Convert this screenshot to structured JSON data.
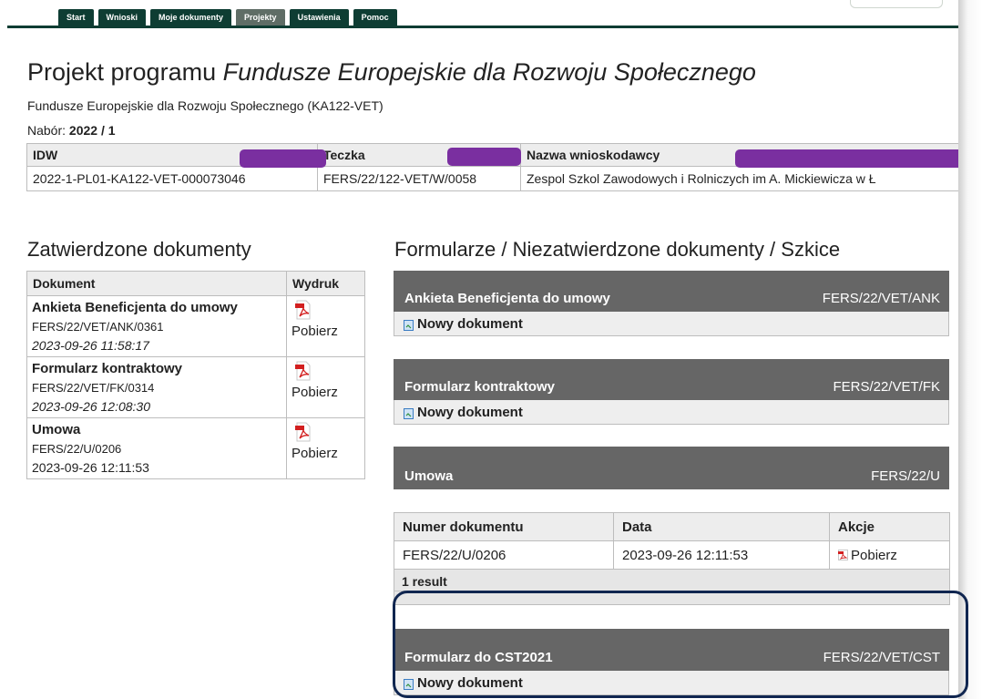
{
  "nav": {
    "tabs": [
      "Start",
      "Wnioski",
      "Moje dokumenty",
      "Projekty",
      "Ustawienia",
      "Pomoc"
    ],
    "active": "Projekty"
  },
  "header": {
    "title_prefix": "Projekt programu ",
    "title_italic": "Fundusze Europejskie dla Rozwoju Społecznego",
    "subtitle": "Fundusze Europejskie dla Rozwoju Społecznego (KA122-VET)",
    "nabor_label": "Nabór: ",
    "nabor_value": "2022 / 1"
  },
  "idw_table": {
    "headers": [
      "IDW",
      "Teczka",
      "Nazwa wnioskodawcy"
    ],
    "row": [
      "2022-1-PL01-KA122-VET-000073046",
      "FERS/22/122-VET/W/0058",
      "Zespol Szkol Zawodowych i Rolniczych im A. Mickiewicza w Ł"
    ]
  },
  "approved": {
    "title": "Zatwierdzone dokumenty",
    "headers": [
      "Dokument",
      "Wydruk"
    ],
    "rows": [
      {
        "name": "Ankieta Beneficjenta do umowy",
        "number": "FERS/22/VET/ANK/0361",
        "date": "2023-09-26 11:58:17",
        "action": "Pobierz"
      },
      {
        "name": "Formularz kontraktowy",
        "number": "FERS/22/VET/FK/0314",
        "date": "2023-09-26 12:08:30",
        "action": "Pobierz"
      },
      {
        "name": "Umowa",
        "number": "FERS/22/U/0206",
        "date": "2023-09-26 12:11:53",
        "action": "Pobierz"
      }
    ]
  },
  "forms": {
    "title": "Formularze / Niezatwierdzone dokumenty / Szkice",
    "blocks": [
      {
        "name": "Ankieta Beneficjenta do umowy",
        "code": "FERS/22/VET/ANK",
        "action": "Nowy dokument"
      },
      {
        "name": "Formularz kontraktowy",
        "code": "FERS/22/VET/FK",
        "action": "Nowy dokument"
      },
      {
        "name": "Umowa",
        "code": "FERS/22/U"
      },
      {
        "name": "Formularz do CST2021",
        "code": "FERS/22/VET/CST",
        "action": "Nowy dokument"
      }
    ],
    "umowa_table": {
      "headers": [
        "Numer dokumentu",
        "Data",
        "Akcje"
      ],
      "row": [
        "FERS/22/U/0206",
        "2023-09-26 12:11:53",
        "Pobierz"
      ],
      "result": "1 result"
    }
  },
  "colors": {
    "nav_bg": "#0e3d33",
    "section_header": "#666666",
    "redaction": "#7a2fa0",
    "highlight_border": "#102650"
  }
}
